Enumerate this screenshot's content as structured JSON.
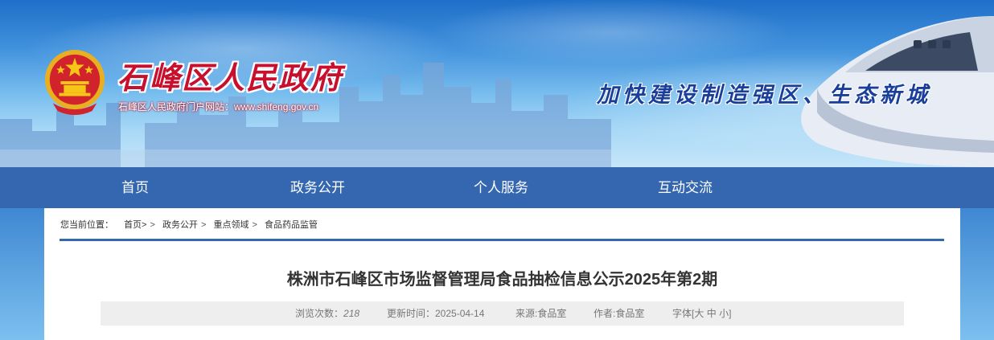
{
  "header": {
    "site_name": "石峰区人民政府",
    "site_url": "石峰区人民政府门户网站：www.shifeng.gov.cn",
    "slogan": "加快建设制造强区、生态新城"
  },
  "nav": {
    "items": [
      {
        "label": "首页"
      },
      {
        "label": "政务公开"
      },
      {
        "label": "个人服务"
      },
      {
        "label": "互动交流"
      }
    ]
  },
  "breadcrumb": {
    "lead": "您当前位置：",
    "items": [
      "首页>",
      "政务公开",
      "重点领域",
      "食品药品监管"
    ],
    "separator": ">"
  },
  "article": {
    "title": "株洲市石峰区市场监督管理局食品抽检信息公示2025年第2期",
    "views_label": "浏览次数：",
    "views": "218",
    "updated": "更新时间：2025-04-14",
    "source": "来源:食品室",
    "author": "作者:食品室",
    "font_label": "字体[",
    "font_large": "大",
    "font_medium": "中",
    "font_small": "小",
    "font_close": "]"
  },
  "colors": {
    "nav_bg": "#3567b0",
    "site_name": "#c8102e",
    "slogan": "#1a3f9a"
  },
  "icons": {
    "emblem": "national-emblem-icon"
  }
}
